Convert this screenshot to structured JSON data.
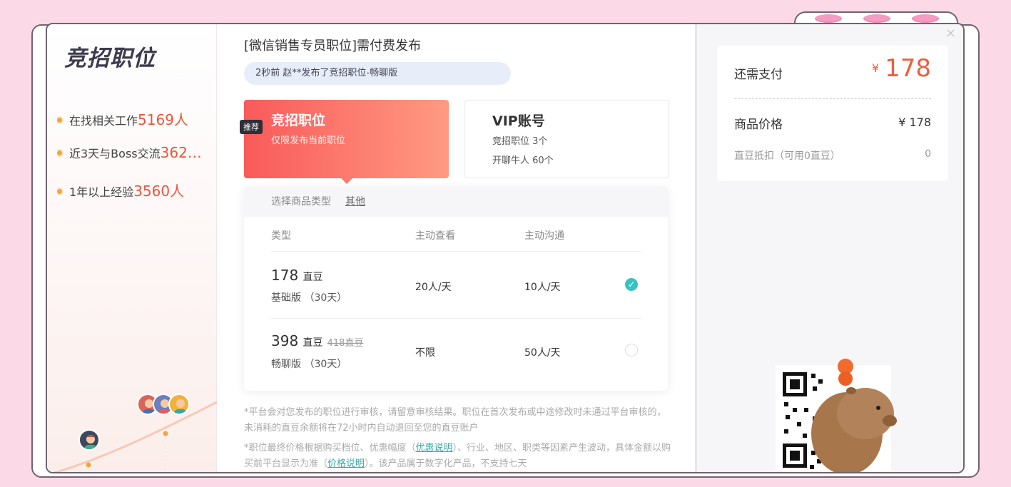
{
  "left": {
    "title": "竞招职位",
    "stats": [
      {
        "label": "在找相关工作",
        "value": "5169人"
      },
      {
        "label": "近3天与Boss交流",
        "value": "362…"
      },
      {
        "label": "1年以上经验",
        "value": "3560人"
      }
    ]
  },
  "header": {
    "job_title": "[微信销售专员职位]需付费发布",
    "notice": "2秒前 赵**发布了竞招职位-畅聊版"
  },
  "plans": {
    "main": {
      "badge": "推荐",
      "title": "竞招职位",
      "subtitle": "仅限发布当前职位"
    },
    "vip": {
      "title": "VIP账号",
      "line1": "竞招职位 3个",
      "line2": "开聊牛人 60个"
    }
  },
  "options": {
    "head_label": "选择商品类型",
    "head_other": "其他",
    "columns": [
      "类型",
      "主动查看",
      "主动沟通"
    ],
    "rows": [
      {
        "price": "178",
        "unit": "直豆",
        "old_price": "",
        "edition": "基础版 （30天）",
        "view": "20人/天",
        "chat": "10人/天",
        "selected": true
      },
      {
        "price": "398",
        "unit": "直豆",
        "old_price": "418直豆",
        "edition": "畅聊版 （30天）",
        "view": "不限",
        "chat": "50人/天",
        "selected": false
      }
    ],
    "check_glyph": "✓"
  },
  "disclaimer": {
    "p1": "*平台会对您发布的职位进行审核，请留意审核结果。职位在首次发布或中途修改时未通过平台审核的，未消耗的直豆余额将在72小时内自动退回至您的直豆账户",
    "p2_a": "*职位最终价格根据购买档位、优惠幅度（",
    "p2_link1": "优惠说明",
    "p2_b": "）、行业、地区、职类等因素产生波动，具体金额以购买前平台显示为准（",
    "p2_link2": "价格说明",
    "p2_c": "）。该产品属于数字化产品，不支持七天"
  },
  "payment": {
    "due_label": "还需支付",
    "currency": "¥",
    "due_amount": "178",
    "price_label": "商品价格",
    "price_value": "¥ 178",
    "deduct_label": "直豆抵扣（可用0直豆）",
    "deduct_value": "0",
    "close_glyph": "×"
  },
  "colors": {
    "accent": "#ef5d3c",
    "teal": "#37c3c0",
    "frame": "#6f6470",
    "bg": "#fcd9e6"
  }
}
